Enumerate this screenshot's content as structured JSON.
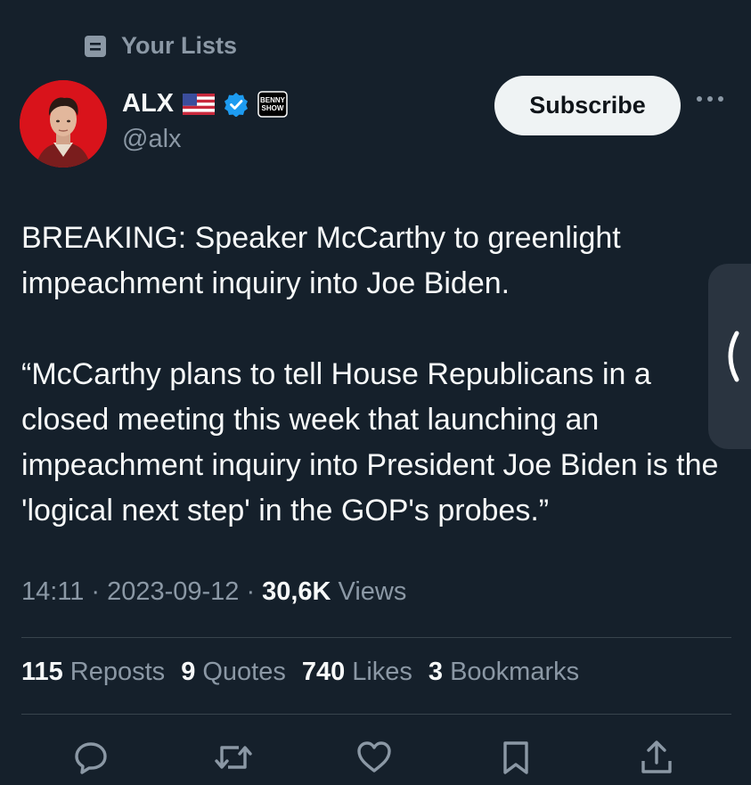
{
  "header": {
    "lists_label": "Your Lists"
  },
  "author": {
    "display_name": "ALX",
    "handle": "@alx",
    "flag_icon": "us-flag-icon",
    "verified_icon": "verified-badge-icon",
    "affiliate_badge": "benny-show-badge-icon",
    "affiliate_badge_text_1": "BENNY",
    "affiliate_badge_text_2": "SHOW"
  },
  "subscribe_label": "Subscribe",
  "tweet": {
    "paragraph_1": "BREAKING: Speaker McCarthy to greenlight impeachment inquiry into Joe Biden.",
    "paragraph_2": "“McCarthy plans to tell House Republicans in a closed meeting this week that launching an impeachment inquiry into President Joe Biden is the 'logical next step' in the GOP's probes.”"
  },
  "meta": {
    "time": "14:11",
    "separator": "·",
    "date": "2023-09-12",
    "views_count": "30,6K",
    "views_label": "Views"
  },
  "stats": [
    {
      "count": "115",
      "label": "Reposts"
    },
    {
      "count": "9",
      "label": "Quotes"
    },
    {
      "count": "740",
      "label": "Likes"
    },
    {
      "count": "3",
      "label": "Bookmarks"
    }
  ],
  "actions": [
    "reply-icon",
    "repost-icon",
    "like-icon",
    "bookmark-icon",
    "share-icon"
  ],
  "colors": {
    "background": "#15202b",
    "text_primary": "#f7f9f9",
    "text_secondary": "#8b98a5",
    "verified_blue": "#1d9bf0",
    "subscribe_bg": "#eff3f4"
  }
}
